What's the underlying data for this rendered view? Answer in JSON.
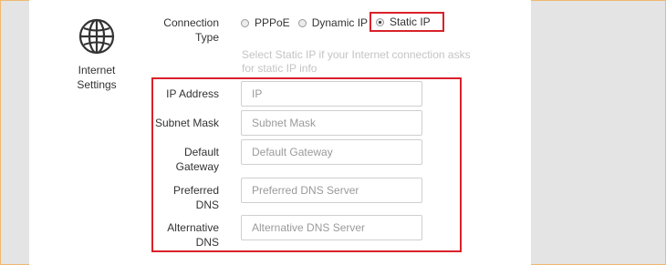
{
  "section": {
    "title_line1": "Internet",
    "title_line2": "Settings",
    "icon": "globe-icon"
  },
  "connection_type": {
    "label_line1": "Connection",
    "label_line2": "Type",
    "options": [
      "PPPoE",
      "Dynamic IP",
      "Static IP"
    ],
    "selected": "Static IP",
    "hint_line1": "Select Static IP if your Internet connection asks",
    "hint_line2": "for static IP info"
  },
  "fields": {
    "ip": {
      "label": "IP Address",
      "placeholder": "IP",
      "value": ""
    },
    "subnet": {
      "label": "Subnet Mask",
      "placeholder": "Subnet Mask",
      "value": ""
    },
    "gateway": {
      "label_line1": "Default",
      "label_line2": "Gateway",
      "placeholder": "Default Gateway",
      "value": ""
    },
    "preferred_dns": {
      "label_line1": "Preferred",
      "label_line2": "DNS",
      "placeholder": "Preferred DNS Server",
      "value": ""
    },
    "alternative_dns": {
      "label_line1": "Alternative",
      "label_line2": "DNS",
      "placeholder": "Alternative DNS Server",
      "value": ""
    }
  },
  "colors": {
    "highlight": "#d9212b",
    "frame": "#f0b870",
    "background": "#e4e4e4"
  }
}
